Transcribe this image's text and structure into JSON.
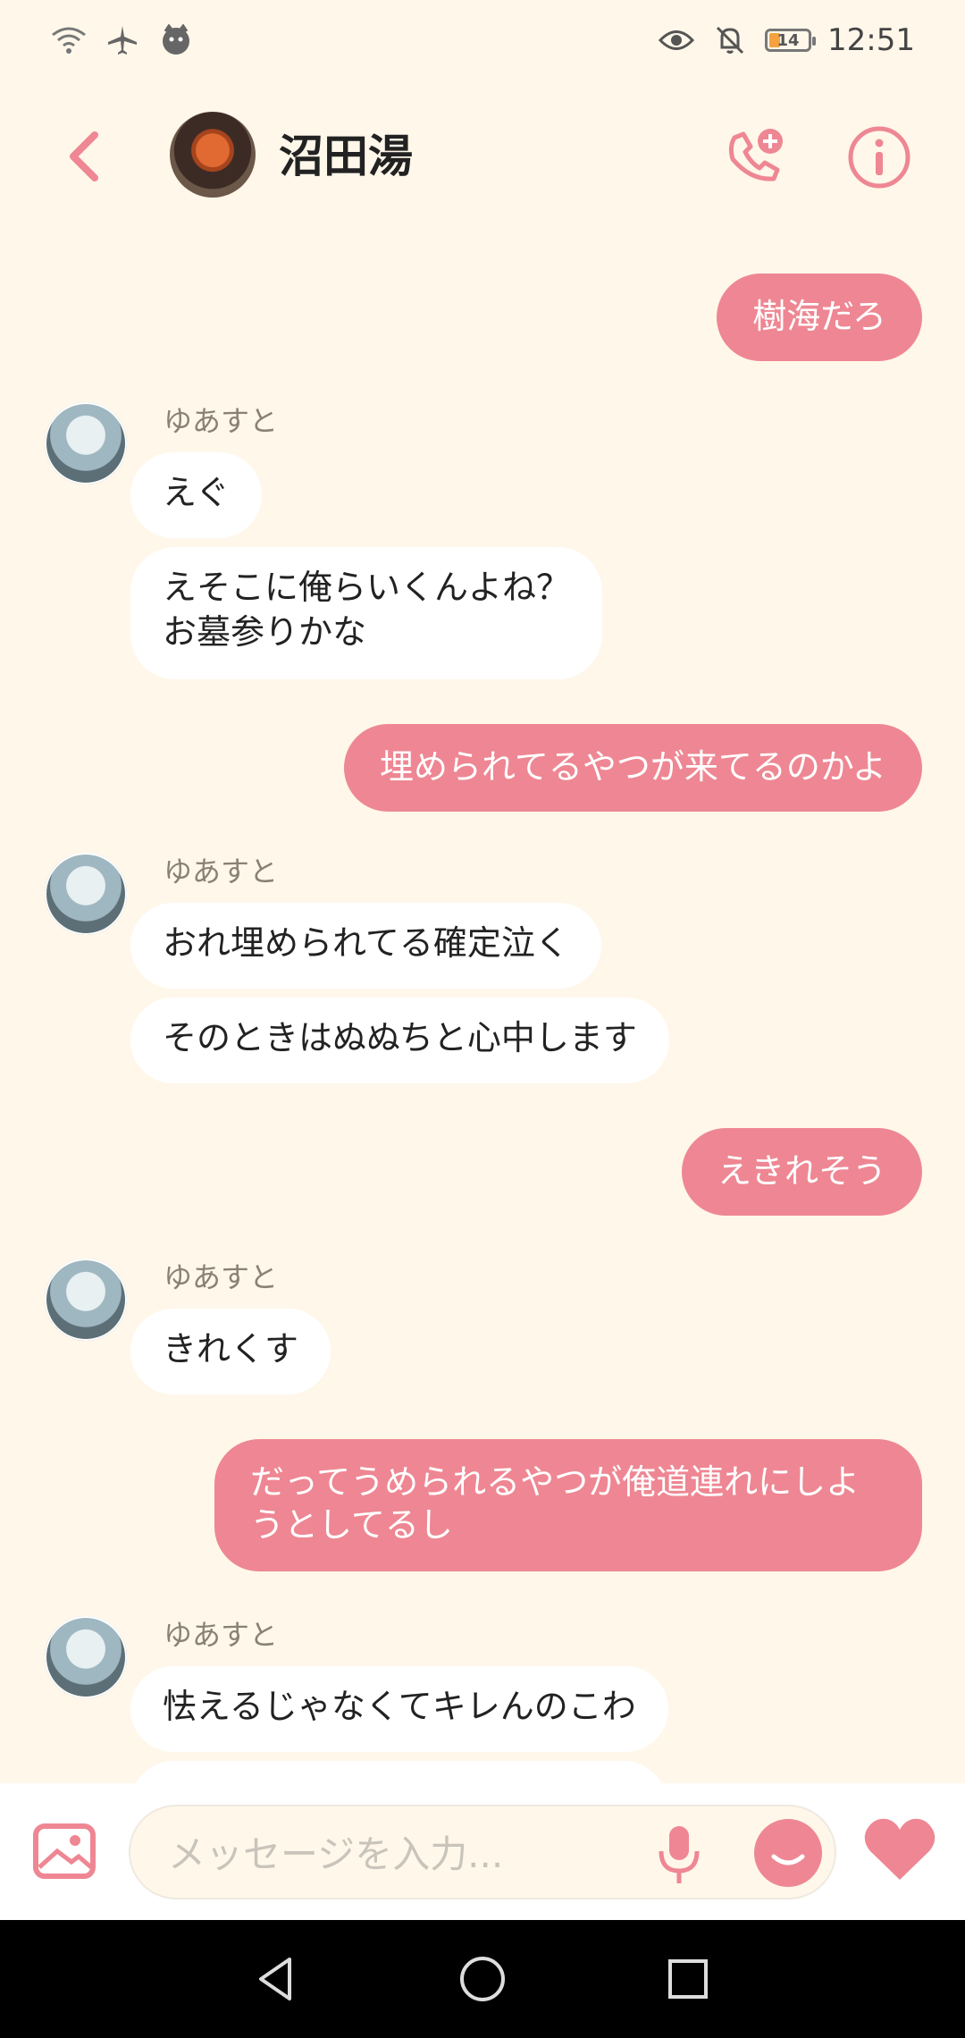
{
  "status_bar": {
    "battery_level": "14",
    "time": "12:51"
  },
  "header": {
    "contact_name": "沼田湯"
  },
  "messages": [
    {
      "dir": "out",
      "text": "樹海だろ"
    },
    {
      "dir": "in",
      "sender": "ゆあすと",
      "bubbles": [
        "えぐ",
        "えそこに俺らいくんよね？\nお墓参りかな"
      ]
    },
    {
      "dir": "out",
      "text": "埋められてるやつが来てるのかよ"
    },
    {
      "dir": "in",
      "sender": "ゆあすと",
      "bubbles": [
        "おれ埋められてる確定泣く",
        "そのときはぬぬちと心中します"
      ]
    },
    {
      "dir": "out",
      "text": "えきれそう"
    },
    {
      "dir": "in",
      "sender": "ゆあすと",
      "bubbles": [
        "きれくす"
      ]
    },
    {
      "dir": "out",
      "text": "だってうめられるやつが俺道連れにしようとしてるし"
    },
    {
      "dir": "in",
      "sender": "ゆあすと",
      "bubbles": [
        "怯えるじゃなくてキレんのこわ"
      ]
    }
  ],
  "input": {
    "placeholder": "メッセージを入力..."
  },
  "colors": {
    "accent": "#EE8793",
    "background": "#FFF7EA",
    "incoming_bubble": "#FFFFFF"
  }
}
